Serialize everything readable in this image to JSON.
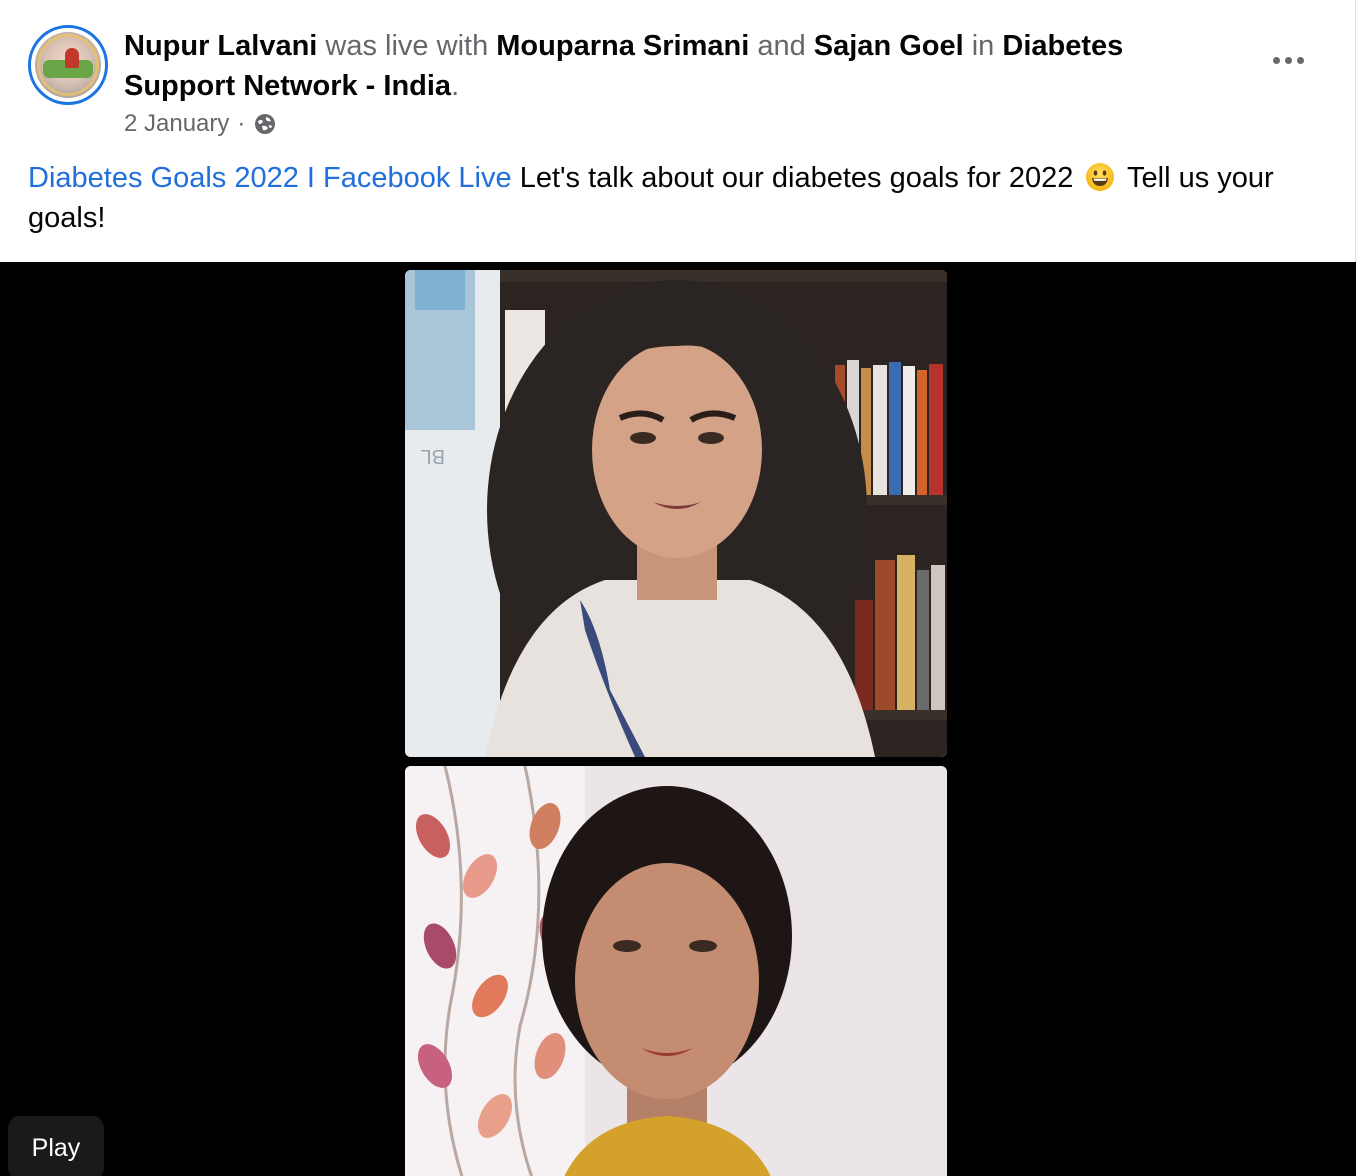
{
  "post": {
    "author": "Nupur Lalvani",
    "live_with_text": "was live with",
    "person1": "Mouparna Srimani",
    "and_text": "and",
    "person2": "Sajan Goel",
    "in_text": "in",
    "group": "Diabetes Support Network - India",
    "period": ".",
    "date": "2 January",
    "separator": "·",
    "audience_icon": "globe-icon",
    "more_icon": "more-options-icon",
    "link_text": "Diabetes Goals 2022 I Facebook Live",
    "body_text_before_emoji": "Let's talk about our diabetes goals for 2022",
    "emoji": "grinning-face-emoji",
    "body_text_after_emoji": "Tell us your goals!"
  },
  "video": {
    "play_label": "Play",
    "participants": [
      "top-participant-video",
      "bottom-participant-video"
    ]
  },
  "colors": {
    "link": "#216fdb",
    "muted": "#65676b",
    "avatar_ring": "#1b74e4",
    "video_bg": "#000000"
  }
}
